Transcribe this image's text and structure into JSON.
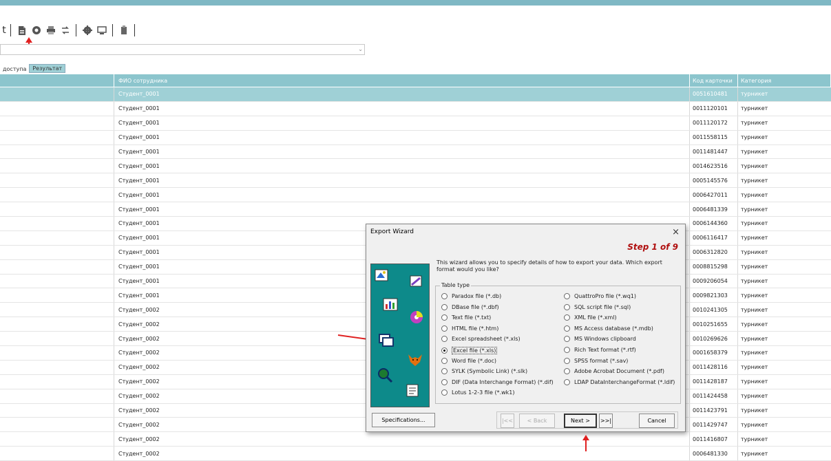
{
  "toolbar": {
    "left_fragment": "t",
    "icons": [
      "export-icon",
      "settings-icon",
      "print-icon",
      "refresh-icon",
      "gear-icon",
      "preview-icon",
      "clipboard-icon"
    ]
  },
  "tabs": [
    {
      "label": "доступа",
      "active": false
    },
    {
      "label": "Результат",
      "active": true
    }
  ],
  "grid": {
    "headers": [
      "",
      "ФИО сотрудника",
      "Код карточки",
      "Категория"
    ],
    "rows": [
      {
        "name": "Студент_0001",
        "code": "0051610481",
        "category": "турникет",
        "selected": true
      },
      {
        "name": "Студент_0001",
        "code": "0011120101",
        "category": "турникет"
      },
      {
        "name": "Студент_0001",
        "code": "0011120172",
        "category": "турникет"
      },
      {
        "name": "Студент_0001",
        "code": "0011558115",
        "category": "турникет"
      },
      {
        "name": "Студент_0001",
        "code": "0011481447",
        "category": "турникет"
      },
      {
        "name": "Студент_0001",
        "code": "0014623516",
        "category": "турникет"
      },
      {
        "name": "Студент_0001",
        "code": "0005145576",
        "category": "турникет"
      },
      {
        "name": "Студент_0001",
        "code": "0006427011",
        "category": "турникет"
      },
      {
        "name": "Студент_0001",
        "code": "0006481339",
        "category": "турникет"
      },
      {
        "name": "Студент_0001",
        "code": "0006144360",
        "category": "турникет"
      },
      {
        "name": "Студент_0001",
        "code": "0006116417",
        "category": "турникет"
      },
      {
        "name": "Студент_0001",
        "code": "0006312820",
        "category": "турникет"
      },
      {
        "name": "Студент_0001",
        "code": "0008815298",
        "category": "турникет"
      },
      {
        "name": "Студент_0001",
        "code": "0009206054",
        "category": "турникет"
      },
      {
        "name": "Студент_0001",
        "code": "0009821303",
        "category": "турникет"
      },
      {
        "name": "Студент_0002",
        "code": "0010241305",
        "category": "турникет"
      },
      {
        "name": "Студент_0002",
        "code": "0010251655",
        "category": "турникет"
      },
      {
        "name": "Студент_0002",
        "code": "0010269626",
        "category": "турникет"
      },
      {
        "name": "Студент_0002",
        "code": "0001658379",
        "category": "турникет"
      },
      {
        "name": "Студент_0002",
        "code": "0011428116",
        "category": "турникет"
      },
      {
        "name": "Студент_0002",
        "code": "0011428187",
        "category": "турникет"
      },
      {
        "name": "Студент_0002",
        "code": "0011424458",
        "category": "турникет"
      },
      {
        "name": "Студент_0002",
        "code": "0011423791",
        "category": "турникет"
      },
      {
        "name": "Студент_0002",
        "code": "0011429747",
        "category": "турникет"
      },
      {
        "name": "Студент_0002",
        "code": "0011416807",
        "category": "турникет"
      },
      {
        "name": "Студент_0002",
        "code": "0006481330",
        "category": "турникет"
      }
    ]
  },
  "dialog": {
    "title": "Export Wizard",
    "close": "×",
    "step": "Step 1 of 9",
    "description": "This wizard allows you to specify details of how to export your data. Which export format would you like?",
    "group_label": "Table type",
    "left_options": [
      "Paradox file (*.db)",
      "DBase file (*.dbf)",
      "Text file (*.txt)",
      "HTML file (*.htm)",
      "Excel spreadsheet (*.xls)",
      "Excel file (*.xls)",
      "Word file (*.doc)",
      "SYLK (Symbolic Link) (*.slk)",
      "DIF (Data Interchange Format) (*.dif)",
      "Lotus 1-2-3 file (*.wk1)"
    ],
    "right_options": [
      "QuattroPro file (*.wq1)",
      "SQL script file (*.sql)",
      "XML file (*.xml)",
      "MS Access database (*.mdb)",
      "MS Windows clipboard",
      "Rich Text format (*.rtf)",
      "SPSS format (*.sav)",
      "Adobe Acrobat Document (*.pdf)",
      "LDAP DataInterchangeFormat (*.ldif)"
    ],
    "selected_option": "Excel file (*.xls)",
    "buttons": {
      "specifications": "Specifications...",
      "first": "|<<",
      "back": "< Back",
      "next": "Next >",
      "last": ">>|",
      "cancel": "Cancel"
    }
  },
  "colors": {
    "accent": "#8cc5cd",
    "selected_row": "#9fd0d6",
    "annotation": "#e02020",
    "wizard_panel": "#0d8a8a",
    "step_text": "#b01010"
  }
}
